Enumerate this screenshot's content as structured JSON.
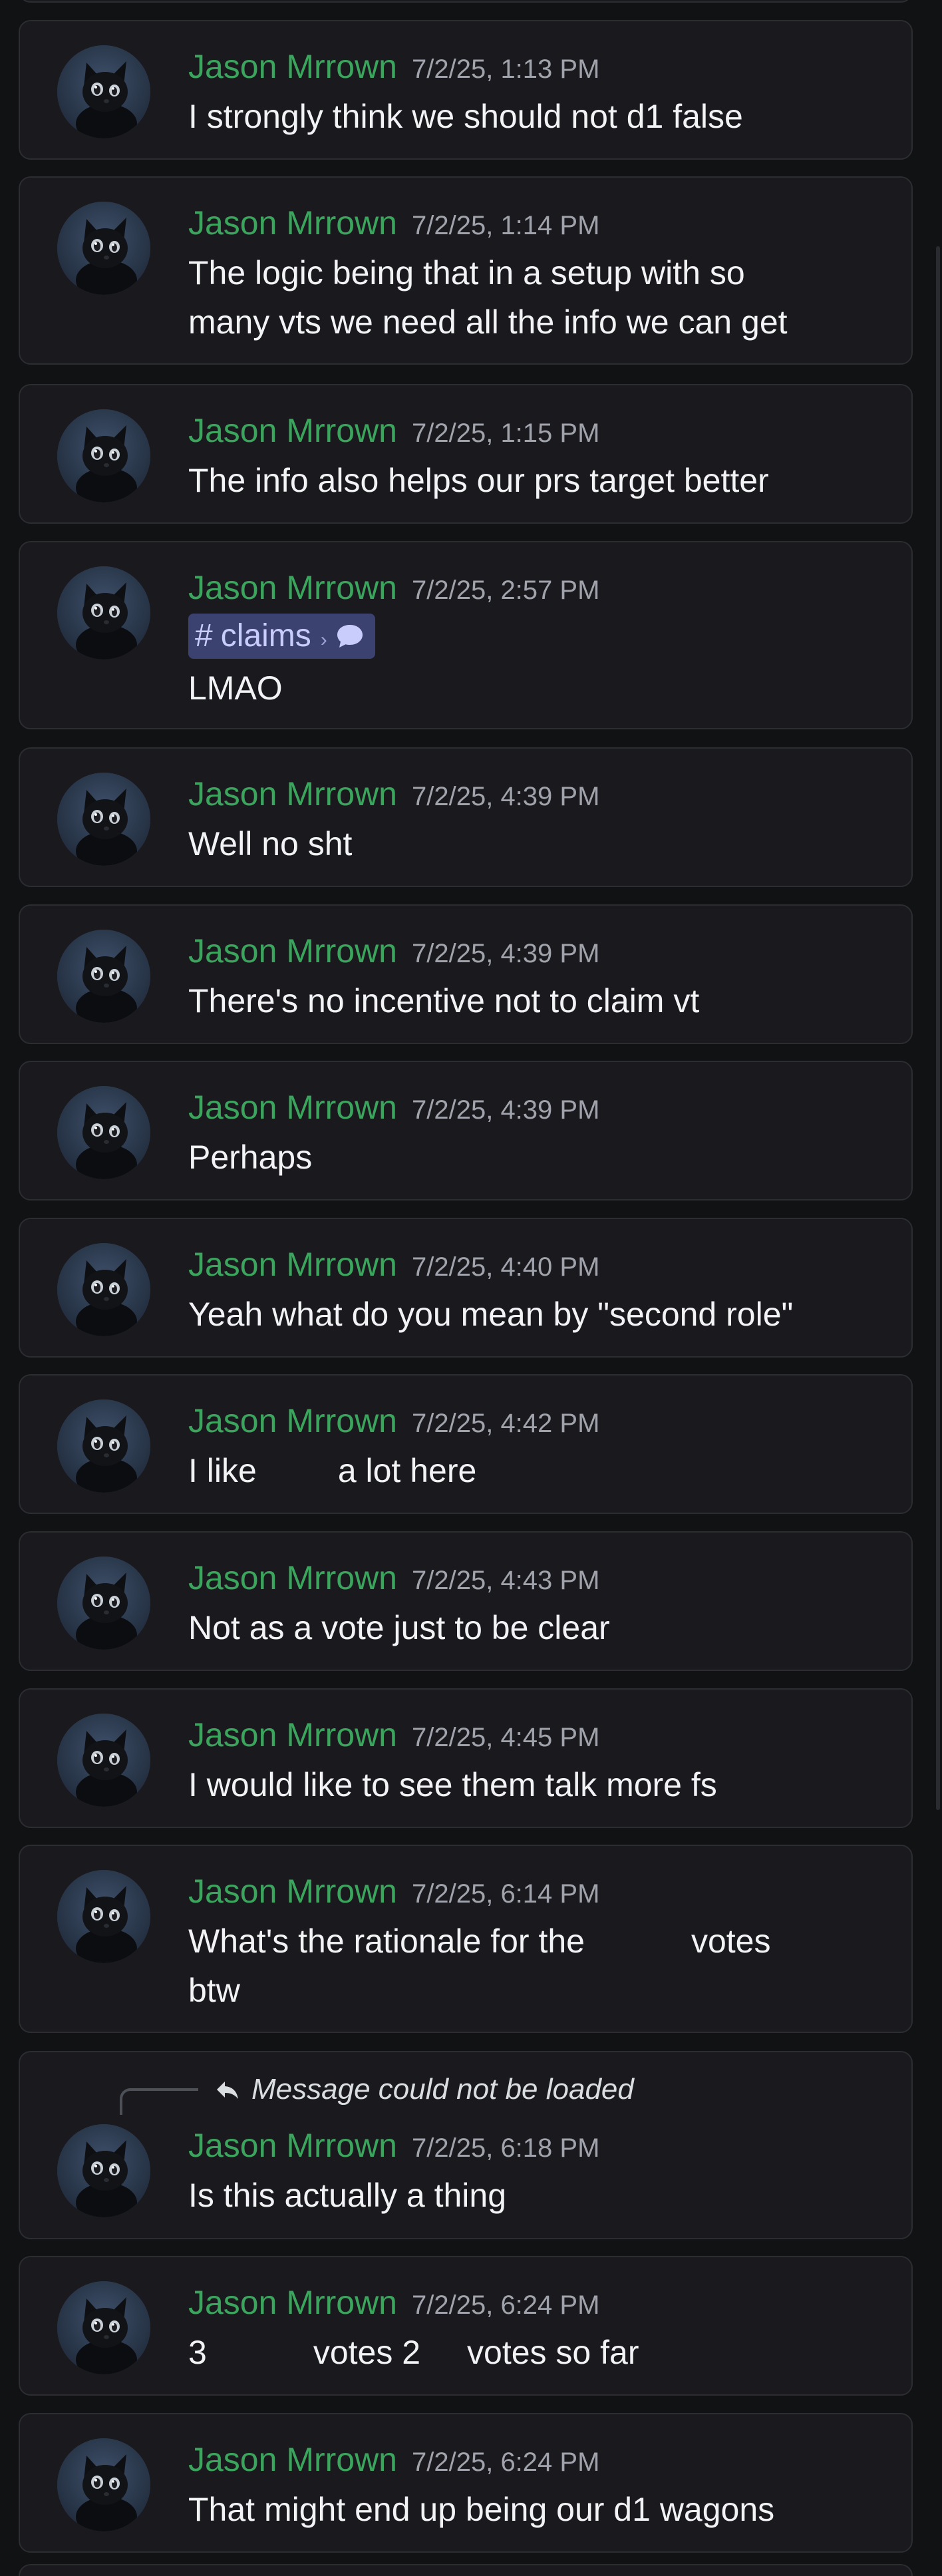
{
  "messages": [
    {
      "author": "Jason Mrrown",
      "timestamp": "7/2/25, 1:13 PM",
      "lines": [
        "I strongly think we should not d1 false"
      ]
    },
    {
      "author": "Jason Mrrown",
      "timestamp": "7/2/25, 1:14 PM",
      "lines": [
        "The logic being that in a setup with so",
        "many vts we need all the info we can get"
      ]
    },
    {
      "author": "Jason Mrrown",
      "timestamp": "7/2/25, 1:15 PM",
      "lines": [
        "The info also helps our prs target better"
      ]
    },
    {
      "author": "Jason Mrrown",
      "timestamp": "7/2/25, 2:57 PM",
      "channel_link": "claims",
      "lines": [
        "LMAO"
      ]
    },
    {
      "author": "Jason Mrrown",
      "timestamp": "7/2/25, 4:39 PM",
      "lines": [
        "Well no sht"
      ]
    },
    {
      "author": "Jason Mrrown",
      "timestamp": "7/2/25, 4:39 PM",
      "lines": [
        "There's no incentive not to claim vt"
      ]
    },
    {
      "author": "Jason Mrrown",
      "timestamp": "7/2/25, 4:39 PM",
      "lines": [
        "Perhaps"
      ]
    },
    {
      "author": "Jason Mrrown",
      "timestamp": "7/2/25, 4:40 PM",
      "lines": [
        "Yeah what do you mean by \"second role\""
      ]
    },
    {
      "author": "Jason Mrrown",
      "timestamp": "7/2/25, 4:42 PM",
      "segments": [
        "I like",
        "a lot here"
      ]
    },
    {
      "author": "Jason Mrrown",
      "timestamp": "7/2/25, 4:43 PM",
      "lines": [
        "Not as a vote just to be clear"
      ]
    },
    {
      "author": "Jason Mrrown",
      "timestamp": "7/2/25, 4:45 PM",
      "lines": [
        "I would like to see them talk more fs"
      ]
    },
    {
      "author": "Jason Mrrown",
      "timestamp": "7/2/25, 6:14 PM",
      "segments": [
        "What's the rationale for the",
        "votes"
      ],
      "line2": "btw"
    },
    {
      "author": "Jason Mrrown",
      "timestamp": "7/2/25, 6:18 PM",
      "reply_notice": "Message could not be loaded",
      "lines": [
        "Is this actually a thing"
      ]
    },
    {
      "author": "Jason Mrrown",
      "timestamp": "7/2/25, 6:24 PM",
      "segments": [
        "3",
        "votes 2",
        "votes so far"
      ]
    },
    {
      "author": "Jason Mrrown",
      "timestamp": "7/2/25, 6:24 PM",
      "lines": [
        "That might end up being our d1 wagons"
      ]
    }
  ],
  "colors": {
    "background": "#111214",
    "card": "#1a1a1e",
    "card_border": "#2b2d31",
    "author": "#3ba55d",
    "timestamp": "#a0a3ab",
    "text": "#f2f3f5",
    "channel_pill": "#3c4270",
    "channel_text": "#c9cdfb"
  },
  "icons": {
    "avatar": "black-cat-avatar-icon",
    "channel": "hash-icon",
    "thread": "speech-bubble-icon",
    "reply": "reply-arrow-icon"
  }
}
